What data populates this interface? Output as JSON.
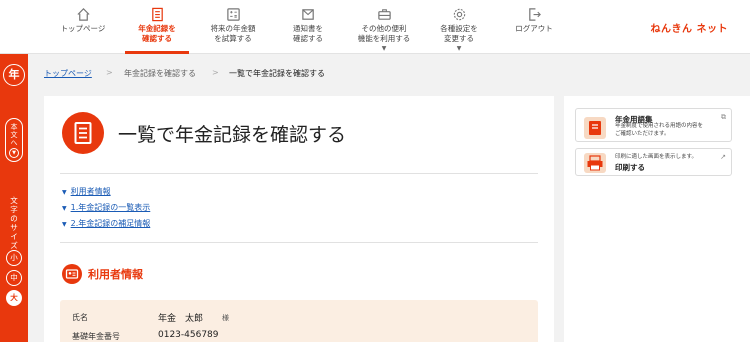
{
  "nav": {
    "items": [
      {
        "label": "トップページ",
        "icon": "home-icon"
      },
      {
        "label": "年金記録を\n確認する",
        "icon": "document-list-icon",
        "active": true
      },
      {
        "label": "将来の年金額\nを試算する",
        "icon": "calculator-icon"
      },
      {
        "label": "通知書を\n確認する",
        "icon": "envelope-icon"
      },
      {
        "label": "その他の便利\n機能を利用する",
        "icon": "toolbox-icon"
      },
      {
        "label": "各種設定を\n変更する",
        "icon": "gear-icon"
      },
      {
        "label": "ログアウト",
        "icon": "logout-icon"
      }
    ],
    "brand": "ねんきん ネット"
  },
  "sidebar": {
    "logo": "年",
    "skip_label": "本文へ",
    "font_size_label": "文字のサイズ",
    "font_sizes": [
      "小",
      "中",
      "大"
    ],
    "selected_font_size": "大"
  },
  "breadcrumb": {
    "items": [
      "トップページ",
      "年金記録を確認する",
      "一覧で年金記録を確認する"
    ],
    "separator": ">"
  },
  "main": {
    "title": "一覧で年金記録を確認する",
    "toc": [
      "利用者情報",
      "1.年金記録の一覧表示",
      "2.年金記録の補足情報"
    ],
    "section_title": "利用者情報",
    "user_info": {
      "name_label": "氏名",
      "name_value": "年金　太郎",
      "name_suffix": "様",
      "number_label": "基礎年金番号",
      "number_value": "0123-456789"
    }
  },
  "right_panel": {
    "glossary": {
      "title": "年金用語集",
      "desc_line1": "年金制度で使用される用語の内容を",
      "desc_line2": "ご確認いただけます。",
      "icon": "book-icon"
    },
    "print": {
      "desc": "印刷に適した画面を表示します。",
      "title": "印刷する",
      "icon": "printer-icon"
    }
  },
  "colors": {
    "accent": "#e8380d",
    "link": "#1a5bb5",
    "info_bg": "#fbeee2",
    "page_bg": "#f2f2f2"
  }
}
